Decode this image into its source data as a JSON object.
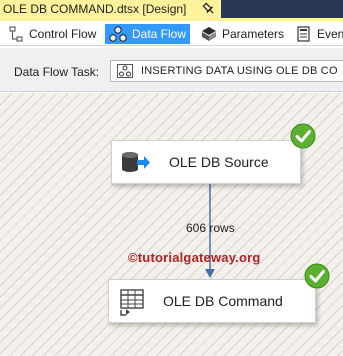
{
  "document_tab": {
    "title": "OLE DB COMMAND.dtsx [Design]",
    "pin_icon": "pin-icon"
  },
  "designer_tabs": [
    {
      "label": "Control Flow",
      "icon": "control-flow-icon",
      "active": false
    },
    {
      "label": "Data Flow",
      "icon": "data-flow-icon",
      "active": true
    },
    {
      "label": "Parameters",
      "icon": "parameters-icon",
      "active": false
    },
    {
      "label": "Even",
      "icon": "event-handlers-icon",
      "active": false
    }
  ],
  "task_selector": {
    "label": "Data Flow Task:",
    "value": "INSERTING DATA USING OLE DB CO",
    "icon": "data-flow-task-icon"
  },
  "canvas": {
    "components": {
      "source": {
        "label": "OLE DB Source",
        "icon": "ole-db-source-icon",
        "status": "success"
      },
      "command": {
        "label": "OLE DB Command",
        "icon": "ole-db-command-icon",
        "status": "success"
      }
    },
    "path": {
      "rows_label": "606 rows"
    },
    "watermark": "©tutorialgateway.org"
  },
  "colors": {
    "tab_background": "#fff29d",
    "tab_strip": "#293955",
    "active_tab": "#3399ff",
    "success_green": "#5cb030",
    "path_line": "#4a6fa5",
    "watermark": "#b22222"
  }
}
